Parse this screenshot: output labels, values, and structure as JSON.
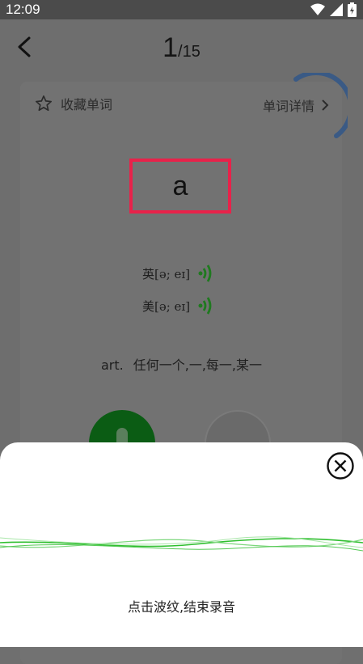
{
  "status_bar": {
    "time": "12:09",
    "icons": [
      "wifi-icon",
      "signal-icon",
      "battery-charging-icon"
    ]
  },
  "header": {
    "back_icon": "chevron-left-icon",
    "current": "1",
    "total": "/15"
  },
  "card": {
    "favorite_icon": "star-outline-icon",
    "favorite_label": "收藏单词",
    "detail_label": "单词详情",
    "detail_icon": "chevron-right-icon",
    "word": "a",
    "phonetics": [
      {
        "label": "英[ə; eɪ]",
        "icon": "speaker-wave-icon"
      },
      {
        "label": "美[ə; eɪ]",
        "icon": "speaker-wave-icon"
      }
    ],
    "part_of_speech": "art.",
    "meaning": "任何一个,一,每一,某一"
  },
  "record_sheet": {
    "close_icon": "close-circle-icon",
    "hint": "点击波纹,结束录音"
  },
  "colors": {
    "highlight_border": "#e8224a",
    "speaker_green": "#1f7a1f",
    "wave_green": "#2fbf2f",
    "mic_green": "#0b5c14",
    "spinner_blue": "#3a5a85"
  }
}
